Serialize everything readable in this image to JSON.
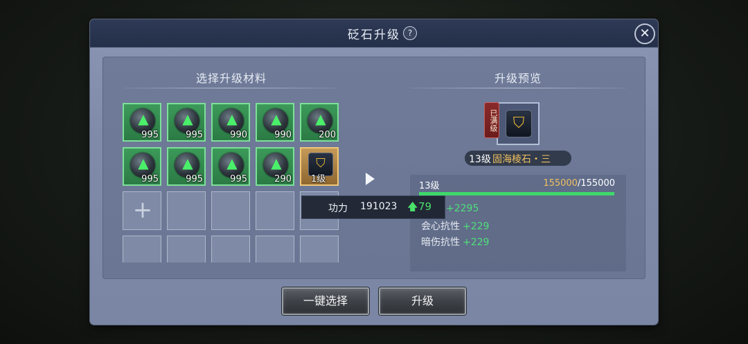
{
  "dialog": {
    "title": "砭石升级",
    "help_icon": "?",
    "close_icon": "✕"
  },
  "materials": {
    "title": "选择升级材料",
    "slots": [
      {
        "type": "material",
        "count": "995"
      },
      {
        "type": "material",
        "count": "995"
      },
      {
        "type": "material",
        "count": "990"
      },
      {
        "type": "material",
        "count": "990"
      },
      {
        "type": "material",
        "count": "200"
      },
      {
        "type": "material",
        "count": "995"
      },
      {
        "type": "material",
        "count": "995"
      },
      {
        "type": "material",
        "count": "995"
      },
      {
        "type": "material",
        "count": "290"
      },
      {
        "type": "gem",
        "level": "1级"
      }
    ],
    "add_icon": "+"
  },
  "tooltip": {
    "label": "功力",
    "value": "191023",
    "up_arrow": "🡅",
    "delta": "79"
  },
  "preview": {
    "title": "升级预览",
    "max_tag": "已满级",
    "gem_level": "13级",
    "gem_name": "固海棱石・三",
    "level_label": "13级",
    "exp_current": "155000",
    "exp_separator": "/",
    "exp_max": "155000",
    "exp_fraction": 1.0,
    "stats": [
      {
        "name": "",
        "value": "+2295"
      },
      {
        "name": "会心抗性",
        "value": "+229"
      },
      {
        "name": "暗伤抗性",
        "value": "+229"
      }
    ]
  },
  "buttons": {
    "auto_select": "一键选择",
    "upgrade": "升级"
  },
  "colors": {
    "material_green": "#2b7a44",
    "gem_gold": "#c59a58",
    "exp_bar": "#3ed86a",
    "stat_green": "#4ee07a",
    "gold_text": "#f0c060"
  }
}
